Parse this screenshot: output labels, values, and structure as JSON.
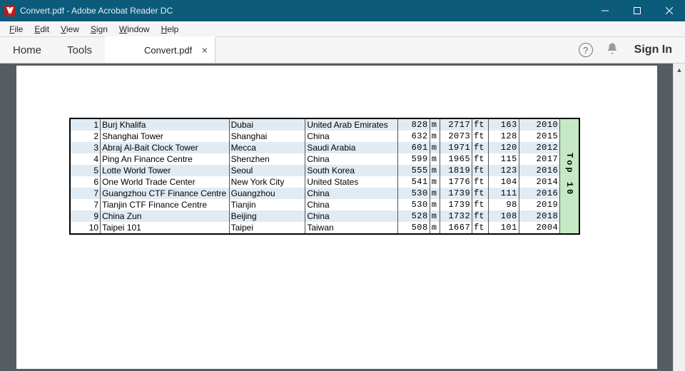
{
  "window": {
    "title": "Convert.pdf - Adobe Acrobat Reader DC"
  },
  "menu": {
    "file": "File",
    "edit": "Edit",
    "view": "View",
    "sign": "Sign",
    "window": "Window",
    "help": "Help"
  },
  "toolbar": {
    "home": "Home",
    "tools": "Tools",
    "tab": "Convert.pdf",
    "signin": "Sign In"
  },
  "table": {
    "side_label": "Top 10",
    "unit_m": "m",
    "unit_ft": "ft",
    "rows": [
      {
        "rank": "1",
        "name": "Burj Khalifa",
        "city": "Dubai",
        "country": "United Arab Emirates",
        "m": "828",
        "ft": "2717",
        "floors": "163",
        "year": "2010"
      },
      {
        "rank": "2",
        "name": "Shanghai Tower",
        "city": "Shanghai",
        "country": "China",
        "m": "632",
        "ft": "2073",
        "floors": "128",
        "year": "2015"
      },
      {
        "rank": "3",
        "name": "Abraj Al-Bait Clock Tower",
        "city": "Mecca",
        "country": "Saudi Arabia",
        "m": "601",
        "ft": "1971",
        "floors": "120",
        "year": "2012"
      },
      {
        "rank": "4",
        "name": "Ping An Finance Centre",
        "city": "Shenzhen",
        "country": "China",
        "m": "599",
        "ft": "1965",
        "floors": "115",
        "year": "2017"
      },
      {
        "rank": "5",
        "name": "Lotte World Tower",
        "city": "Seoul",
        "country": "South Korea",
        "m": "555",
        "ft": "1819",
        "floors": "123",
        "year": "2016"
      },
      {
        "rank": "6",
        "name": "One World Trade Center",
        "city": "New York City",
        "country": "United States",
        "m": "541",
        "ft": "1776",
        "floors": "104",
        "year": "2014"
      },
      {
        "rank": "7",
        "name": "Guangzhou CTF Finance Centre",
        "city": "Guangzhou",
        "country": "China",
        "m": "530",
        "ft": "1739",
        "floors": "111",
        "year": "2016"
      },
      {
        "rank": "7",
        "name": "Tianjin CTF Finance Centre",
        "city": "Tianjin",
        "country": "China",
        "m": "530",
        "ft": "1739",
        "floors": "98",
        "year": "2019"
      },
      {
        "rank": "9",
        "name": "China Zun",
        "city": "Beijing",
        "country": "China",
        "m": "528",
        "ft": "1732",
        "floors": "108",
        "year": "2018"
      },
      {
        "rank": "10",
        "name": "Taipei 101",
        "city": "Taipei",
        "country": "Taiwan",
        "m": "508",
        "ft": "1667",
        "floors": "101",
        "year": "2004"
      }
    ]
  }
}
